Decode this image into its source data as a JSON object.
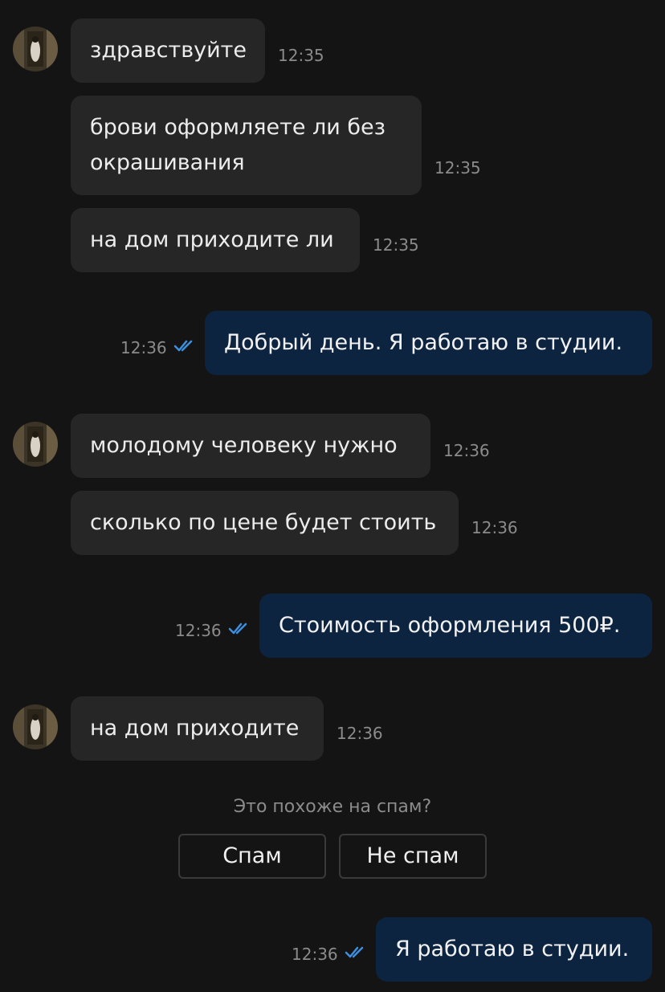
{
  "messages": [
    {
      "text": "здравствуйте",
      "time": "12:35"
    },
    {
      "text_line1": "брови оформляете ли без",
      "text_line2": "окрашивания",
      "time": "12:35"
    },
    {
      "text": "на дом приходите ли",
      "time": "12:35"
    },
    {
      "text": "Добрый день. Я работаю в студии.",
      "time": "12:36"
    },
    {
      "text": "молодому человеку нужно",
      "time": "12:36"
    },
    {
      "text": "сколько по цене будет стоить",
      "time": "12:36"
    },
    {
      "text": "Стоимость оформления 500₽.",
      "time": "12:36"
    },
    {
      "text": "на дом приходите",
      "time": "12:36"
    },
    {
      "text": "Я работаю в студии.",
      "time": "12:36"
    }
  ],
  "spam_prompt": {
    "question": "Это похоже на спам?",
    "spam_label": "Спам",
    "not_spam_label": "Не спам"
  },
  "icons": {
    "avatar": "contact-avatar-photo",
    "read_receipt": "double-check-icon"
  },
  "colors": {
    "background": "#141414",
    "incoming_bubble": "#262626",
    "outgoing_bubble": "#0d2440",
    "read_check": "#3d8fe0",
    "timestamp": "#8b8b8b"
  }
}
